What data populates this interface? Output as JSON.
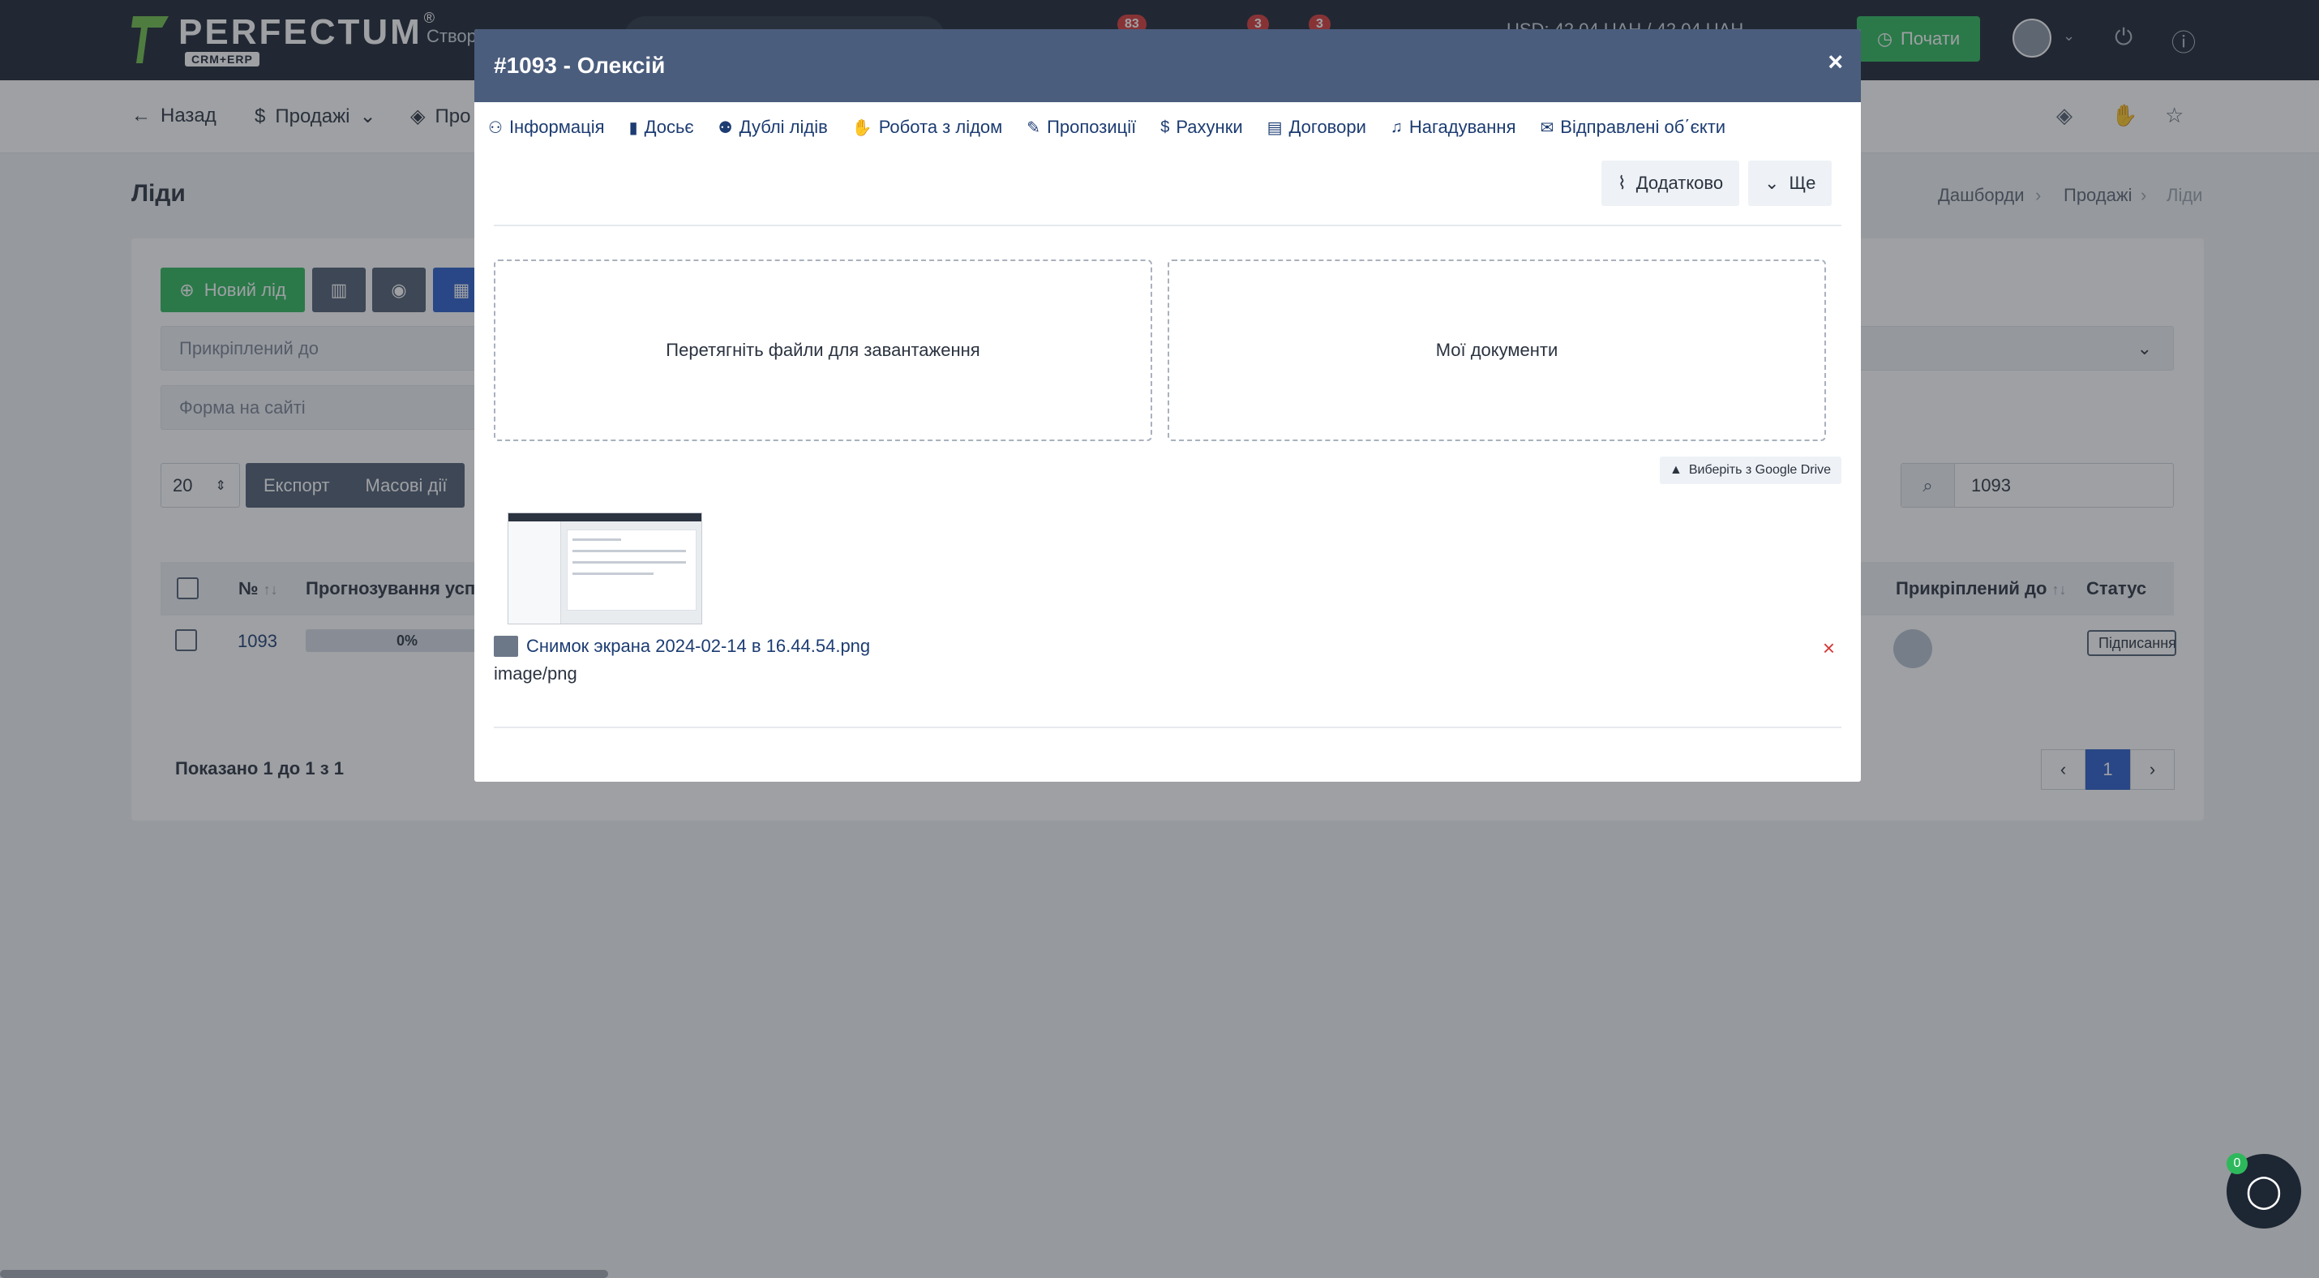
{
  "topbar": {
    "logo_text": "PERFECTUM",
    "logo_sub": "CRM+ERP",
    "logo_reg": "®",
    "create_label": "Створ",
    "badges": [
      "83",
      "3",
      "3"
    ],
    "currency": "USD: 42.04 UAH / 42.04 UAH",
    "start_button": "Почати"
  },
  "subnav": {
    "back": "Назад",
    "sales": "Продажі",
    "products": "Про"
  },
  "page": {
    "title": "Ліди",
    "breadcrumbs": [
      "Дашборди",
      "Продажі",
      "Ліди"
    ]
  },
  "toolbar": {
    "new_lead": "Новий лід",
    "filter_attached": "Прикріплений до",
    "filter_form": "Форма на сайті",
    "per_page": "20",
    "export": "Експорт",
    "mass_actions": "Масові дії",
    "search_value": "1093"
  },
  "table": {
    "headers": {
      "number": "№",
      "forecast": "Прогнозування успіх",
      "attached": "Прикріплений до",
      "status": "Статус"
    },
    "rows": [
      {
        "number": "1093",
        "forecast": "0%",
        "status": "Підписання"
      }
    ],
    "shown": "Показано 1 до 1 з 1",
    "pages": [
      "‹",
      "1",
      "›"
    ]
  },
  "modal": {
    "title": "#1093 - Олексій",
    "close": "×",
    "tabs": [
      {
        "label": "Інформація",
        "icon": "user-icon"
      },
      {
        "label": "Досьє",
        "icon": "book-icon"
      },
      {
        "label": "Дублі лідів",
        "icon": "users-icon"
      },
      {
        "label": "Робота з лідом",
        "icon": "hand-icon"
      },
      {
        "label": "Пропозиції",
        "icon": "pencil-icon"
      },
      {
        "label": "Рахунки",
        "icon": "dollar-icon"
      },
      {
        "label": "Договори",
        "icon": "file-icon"
      },
      {
        "label": "Нагадування",
        "icon": "bell-icon"
      },
      {
        "label": "Відправлені об΄єкти",
        "icon": "mail-icon"
      }
    ],
    "btn_additional": "Додатково",
    "btn_more": "Ще",
    "drop_upload": "Перетягніть файли для завантаження",
    "drop_docs": "Мої документи",
    "google_drive": "Виберіть з Google Drive",
    "file_name": "Снимок экрана 2024-02-14 в 16.44.54.png",
    "file_type": "image/png",
    "delete_label": "×"
  },
  "chat": {
    "badge": "0"
  },
  "colors": {
    "topbar": "#1d2633",
    "modal_header": "#4b5d7d",
    "green": "#2eb85c",
    "blue": "#2a5ecb",
    "link": "#1c3c72",
    "danger": "#d63a3a"
  }
}
